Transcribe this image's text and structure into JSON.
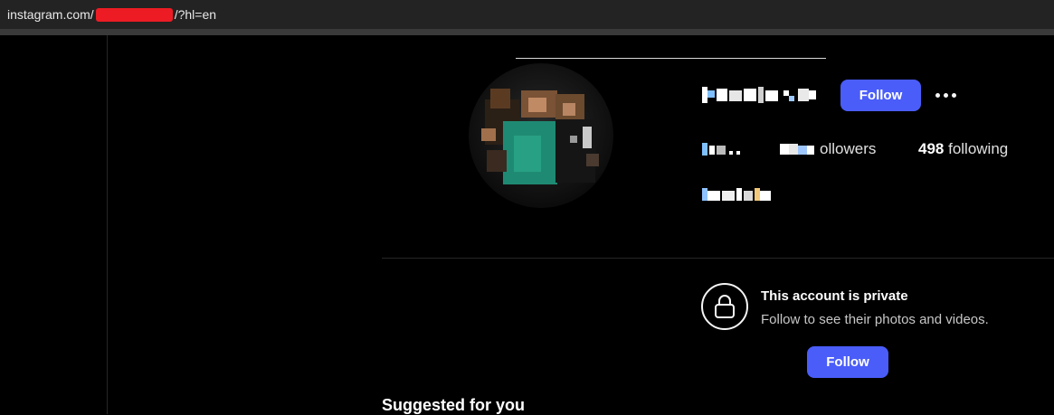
{
  "browser": {
    "url_prefix": "instagram.com/",
    "url_suffix": "/?hl=en"
  },
  "profile": {
    "follow_label": "Follow",
    "more_icon": "more-horizontal-icon",
    "followers_label": "ollowers",
    "following_count": "498",
    "following_label": " following"
  },
  "private_notice": {
    "lock_icon": "lock-icon",
    "title": "This account is private",
    "subtitle": "Follow to see their photos and videos.",
    "follow_label": "Follow"
  },
  "suggested": {
    "heading": "Suggested for you"
  },
  "colors": {
    "accent": "#4a5df9",
    "redaction": "#ed1c24",
    "background": "#000000"
  }
}
